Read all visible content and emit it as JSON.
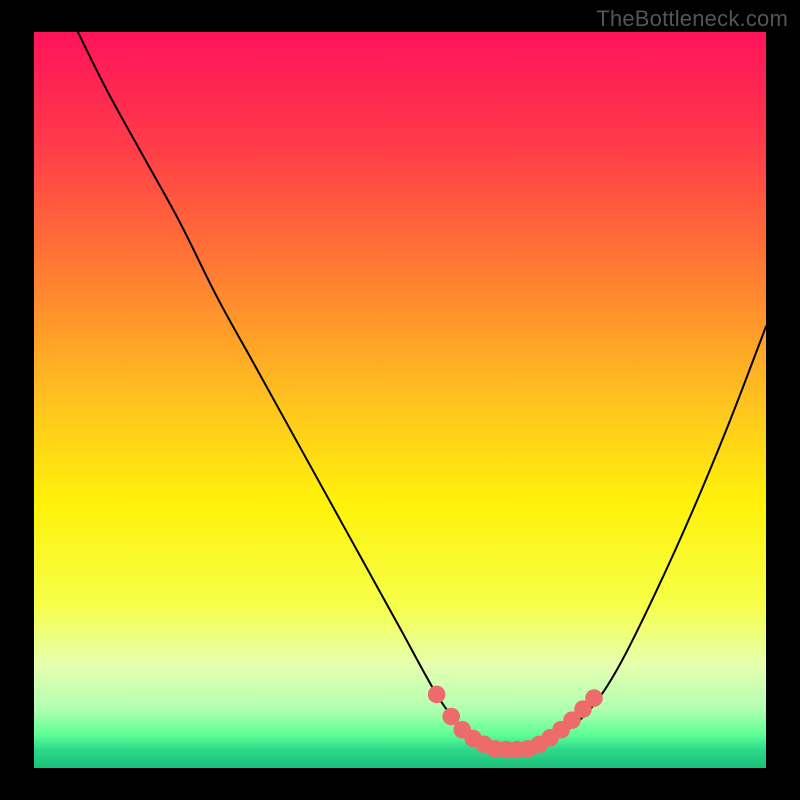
{
  "watermark": "TheBottleneck.com",
  "gradient": {
    "stops": [
      {
        "offset": 0.0,
        "color": "#ff135b"
      },
      {
        "offset": 0.15,
        "color": "#ff3a4a"
      },
      {
        "offset": 0.32,
        "color": "#ff7a33"
      },
      {
        "offset": 0.5,
        "color": "#ffc21f"
      },
      {
        "offset": 0.64,
        "color": "#fff20a"
      },
      {
        "offset": 0.78,
        "color": "#f6ff4a"
      },
      {
        "offset": 0.86,
        "color": "#e6ffb0"
      },
      {
        "offset": 0.92,
        "color": "#b2ffb2"
      },
      {
        "offset": 0.955,
        "color": "#5eff94"
      },
      {
        "offset": 0.975,
        "color": "#2cd98a"
      },
      {
        "offset": 1.0,
        "color": "#1bbf7a"
      }
    ]
  },
  "chart_data": {
    "type": "line",
    "title": "",
    "xlabel": "",
    "ylabel": "",
    "xlim": [
      0,
      100
    ],
    "ylim": [
      0,
      100
    ],
    "series": [
      {
        "name": "bottleneck-curve",
        "x": [
          6,
          10,
          15,
          20,
          25,
          30,
          35,
          40,
          45,
          50,
          55,
          58,
          60,
          62,
          64,
          66,
          68,
          70,
          72,
          76,
          80,
          85,
          90,
          95,
          100
        ],
        "values": [
          100,
          92,
          83,
          74,
          64,
          55,
          46,
          37,
          28,
          19,
          10,
          6,
          4,
          3,
          2.5,
          2.5,
          2.5,
          3,
          4.5,
          8,
          14,
          24,
          35,
          47,
          60
        ]
      }
    ],
    "markers": {
      "name": "highlighted-range",
      "color": "#ed6b6b",
      "radius_frac": 0.012,
      "x": [
        55,
        57,
        58.5,
        60,
        61.5,
        63,
        64.5,
        66,
        67.5,
        69,
        70.5,
        72,
        73.5,
        75,
        76.5
      ],
      "values": [
        10,
        7,
        5.2,
        4,
        3.2,
        2.6,
        2.5,
        2.5,
        2.6,
        3.2,
        4.1,
        5.2,
        6.5,
        8,
        9.5
      ]
    }
  }
}
